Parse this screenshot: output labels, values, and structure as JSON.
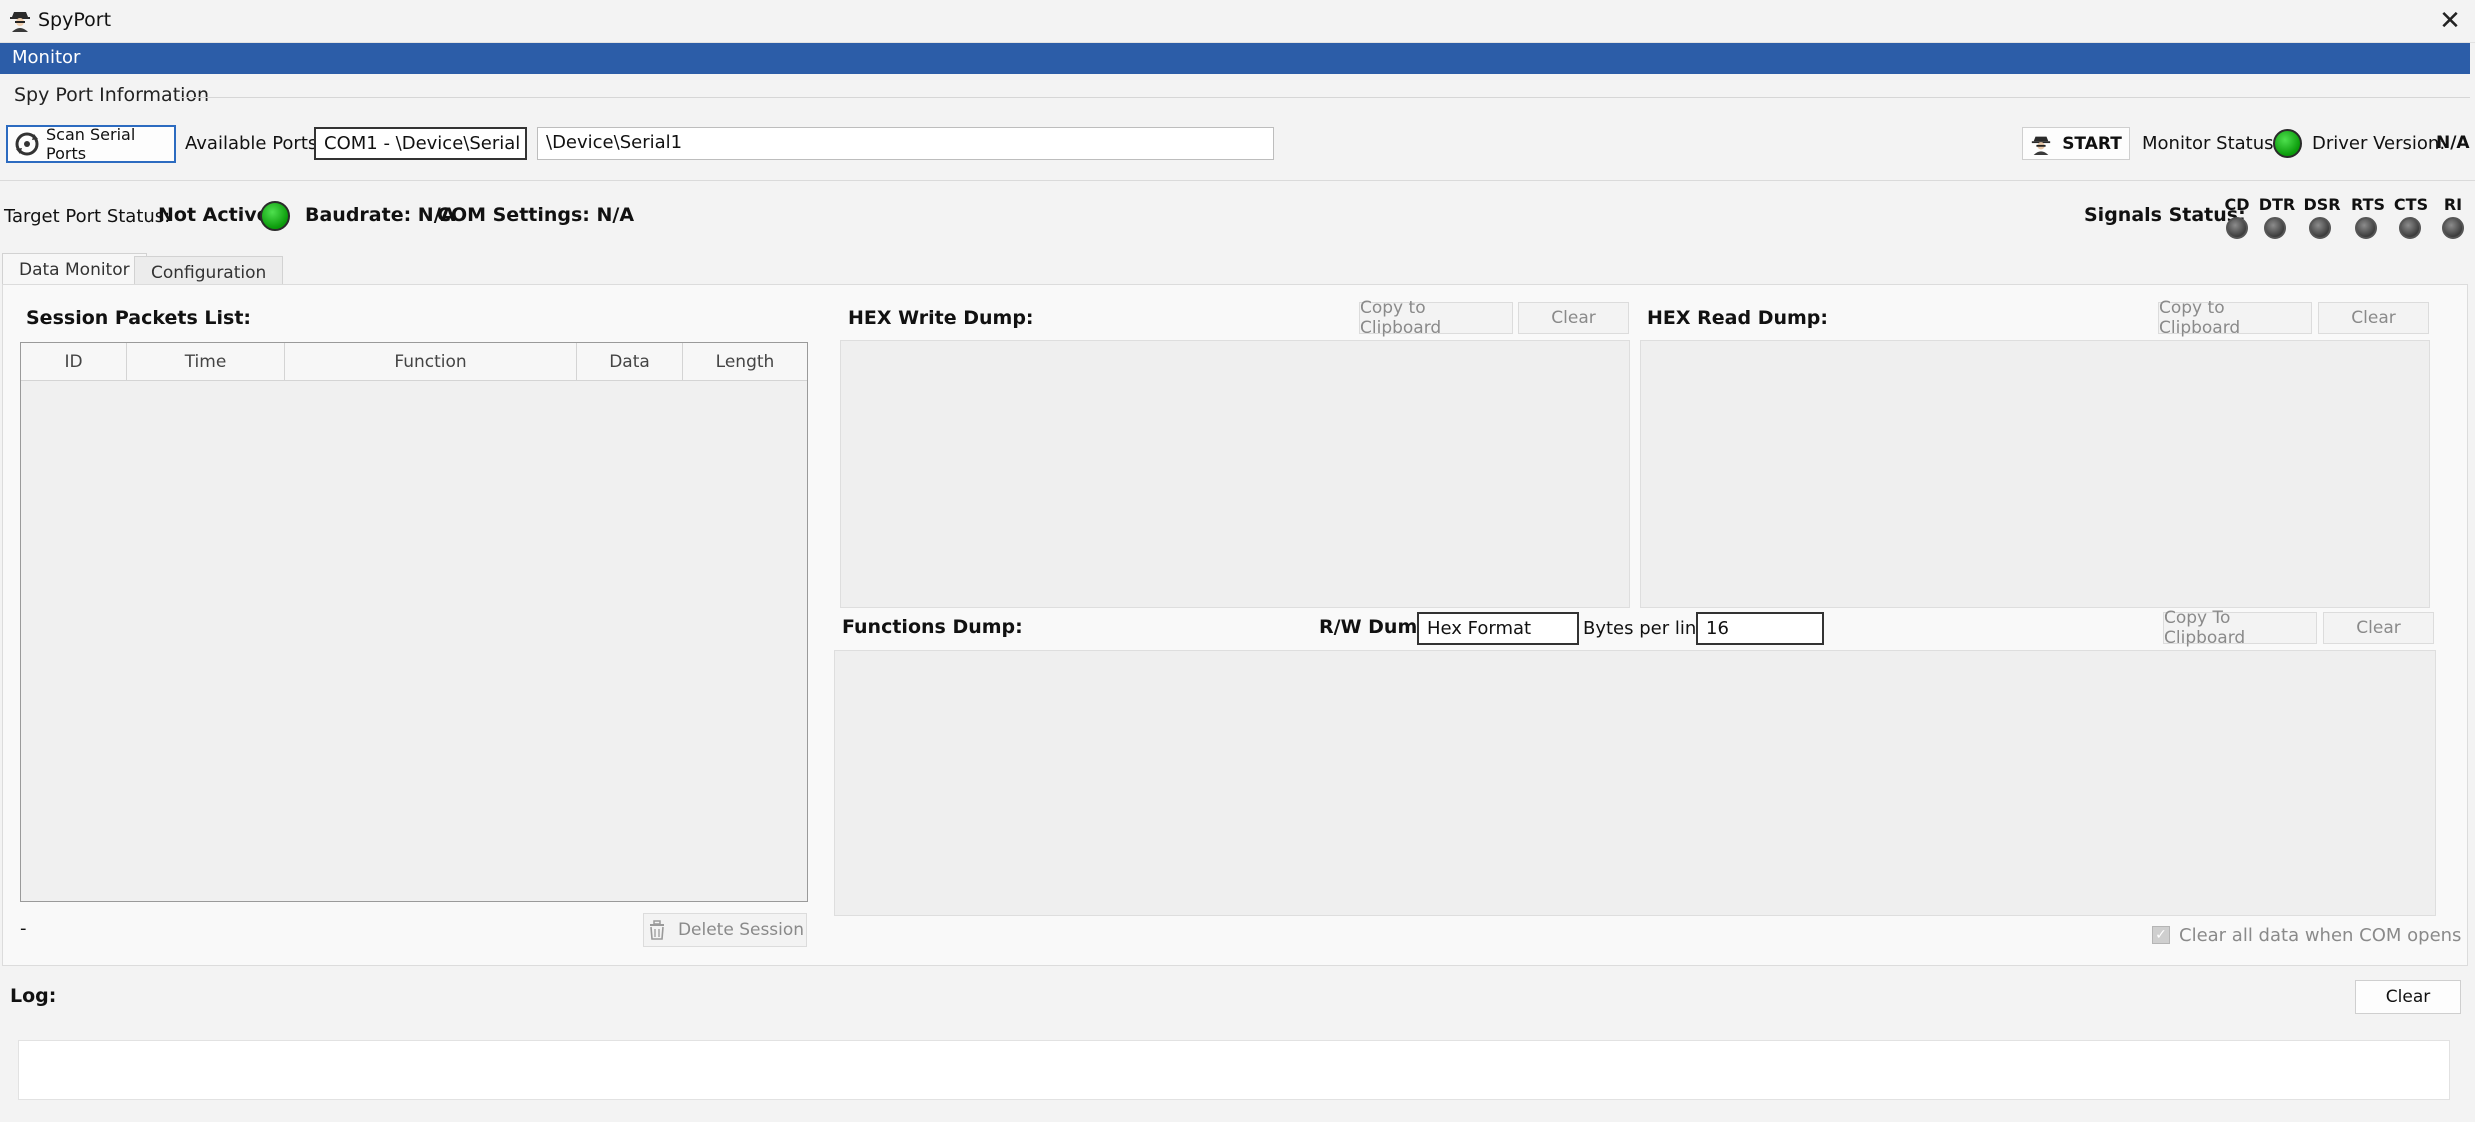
{
  "window": {
    "title": "SpyPort",
    "close_glyph": "✕"
  },
  "menu": {
    "items": [
      "Monitor"
    ]
  },
  "group": {
    "title": "Spy Port Information"
  },
  "toolbar": {
    "scan_label": "Scan Serial Ports",
    "available_ports_label": "Available Ports:",
    "port_select_value": "COM1 - \\Device\\Serial",
    "port_path_value": "\\Device\\Serial1",
    "start_label": "START",
    "monitor_status_label": "Monitor Status:",
    "driver_version_label": "Driver Version:",
    "driver_version_value": "N/A"
  },
  "status": {
    "target_port_label": "Target Port Status:",
    "target_port_value": "Not Active",
    "baudrate_text": "Baudrate: N/A",
    "com_settings_text": "COM Settings: N/A",
    "signals_label": "Signals Status:",
    "signals": [
      "CD",
      "DTR",
      "DSR",
      "RTS",
      "CTS",
      "RI"
    ]
  },
  "tabs": [
    "Data Monitor",
    "Configuration"
  ],
  "session": {
    "title": "Session Packets List:",
    "columns": [
      "ID",
      "Time",
      "Function",
      "Data",
      "Length"
    ],
    "footer_text": "-",
    "delete_label": "Delete Session"
  },
  "hex_write": {
    "title": "HEX Write Dump:",
    "copy_label": "Copy to Clipboard",
    "clear_label": "Clear"
  },
  "hex_read": {
    "title": "HEX Read Dump:",
    "copy_label": "Copy to Clipboard",
    "clear_label": "Clear"
  },
  "functions": {
    "title": "Functions Dump:",
    "rw_label": "R/W Dump:",
    "rw_value": "Hex Format",
    "bytes_label": "Bytes per line:",
    "bytes_value": "16",
    "copy_label": "Copy To Clipboard",
    "clear_label": "Clear",
    "clear_all_label": "Clear all data when COM opens"
  },
  "log": {
    "title": "Log:",
    "clear_label": "Clear"
  },
  "colors": {
    "accent": "#2c5da8",
    "led_green": "#13a313",
    "led_gray": "#4a4a4a"
  }
}
